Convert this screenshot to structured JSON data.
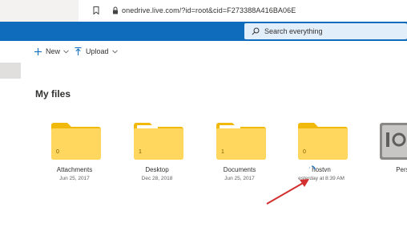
{
  "browser": {
    "url": "onedrive.live.com/?id=root&cid=F273388A416BA06E"
  },
  "search": {
    "placeholder": "Search everything"
  },
  "toolbar": {
    "new_label": "New",
    "upload_label": "Upload"
  },
  "page": {
    "title": "My files"
  },
  "files": [
    {
      "name": "Attachments",
      "date": "Jun 25, 2017",
      "count": "0"
    },
    {
      "name": "Desktop",
      "date": "Dec 28, 2018",
      "count": "1"
    },
    {
      "name": "Documents",
      "date": "Jun 25, 2017",
      "count": "1"
    },
    {
      "name": "hostvn",
      "date": "esterday at 8:39 AM",
      "count": "0"
    },
    {
      "name": "Persona"
    }
  ],
  "colors": {
    "suite_bar": "#0f6cbd",
    "folder": "#ffd75e",
    "folder_dark": "#f0b90b",
    "annotation_arrow": "#d32f2f"
  }
}
